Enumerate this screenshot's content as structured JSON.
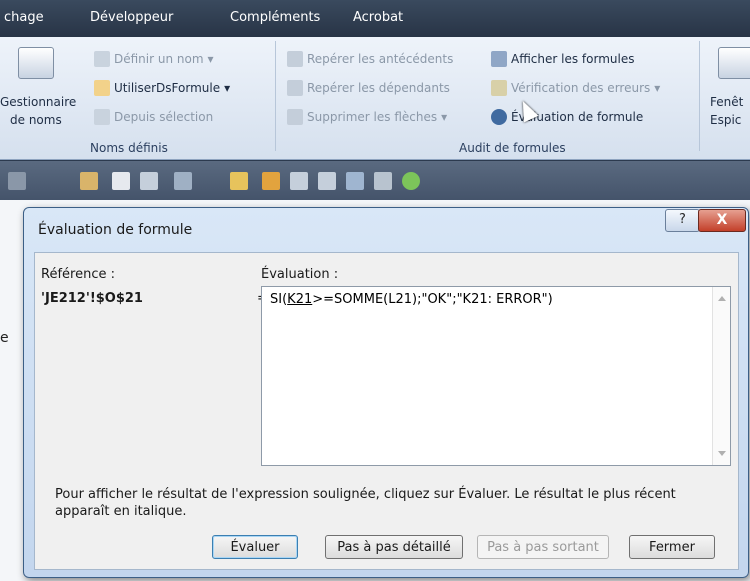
{
  "ribbon_tabs": [
    "chage",
    "Développeur",
    "Compléments",
    "Acrobat"
  ],
  "ribbon": {
    "names_group": {
      "label": "Noms définis",
      "manager_line1": "Gestionnaire",
      "manager_line2": "de noms",
      "define_name": "Définir un nom",
      "use_in_formula": "UtiliserDsFormule",
      "from_selection": "Depuis sélection"
    },
    "audit_group": {
      "label": "Audit de formules",
      "trace_precedents": "Repérer les antécédents",
      "trace_dependents": "Repérer les dépendants",
      "remove_arrows": "Supprimer les flèches",
      "show_formulas": "Afficher les formules",
      "error_check": "Vérification des erreurs",
      "evaluate_formula": "Évaluation de formule"
    },
    "window_group": {
      "line1": "Fenêt",
      "line2": "Espic"
    },
    "dropdown_arrow": "▾"
  },
  "sheet_fragment": "e",
  "dialog": {
    "title": "Évaluation de formule",
    "help": "?",
    "close": "X",
    "reference_label": "Référence :",
    "reference_value": "'JE212'!$O$21",
    "equals": "=",
    "evaluation_label": "Évaluation :",
    "formula_prefix": "SI(",
    "formula_underlined": "K21",
    "formula_suffix": ">=SOMME(L21);\"OK\";\"K21: ERROR\")",
    "hint": "Pour afficher le résultat de l'expression soulignée, cliquez sur Évaluer. Le résultat le plus récent apparaît en italique.",
    "buttons": {
      "evaluate": "Évaluer",
      "step_in": "Pas à pas détaillé",
      "step_out": "Pas à pas sortant",
      "close": "Fermer"
    }
  },
  "colors": {
    "accent": "#3c7fb1",
    "close_red": "#c3402a",
    "ribbon_dark": "#283446"
  }
}
